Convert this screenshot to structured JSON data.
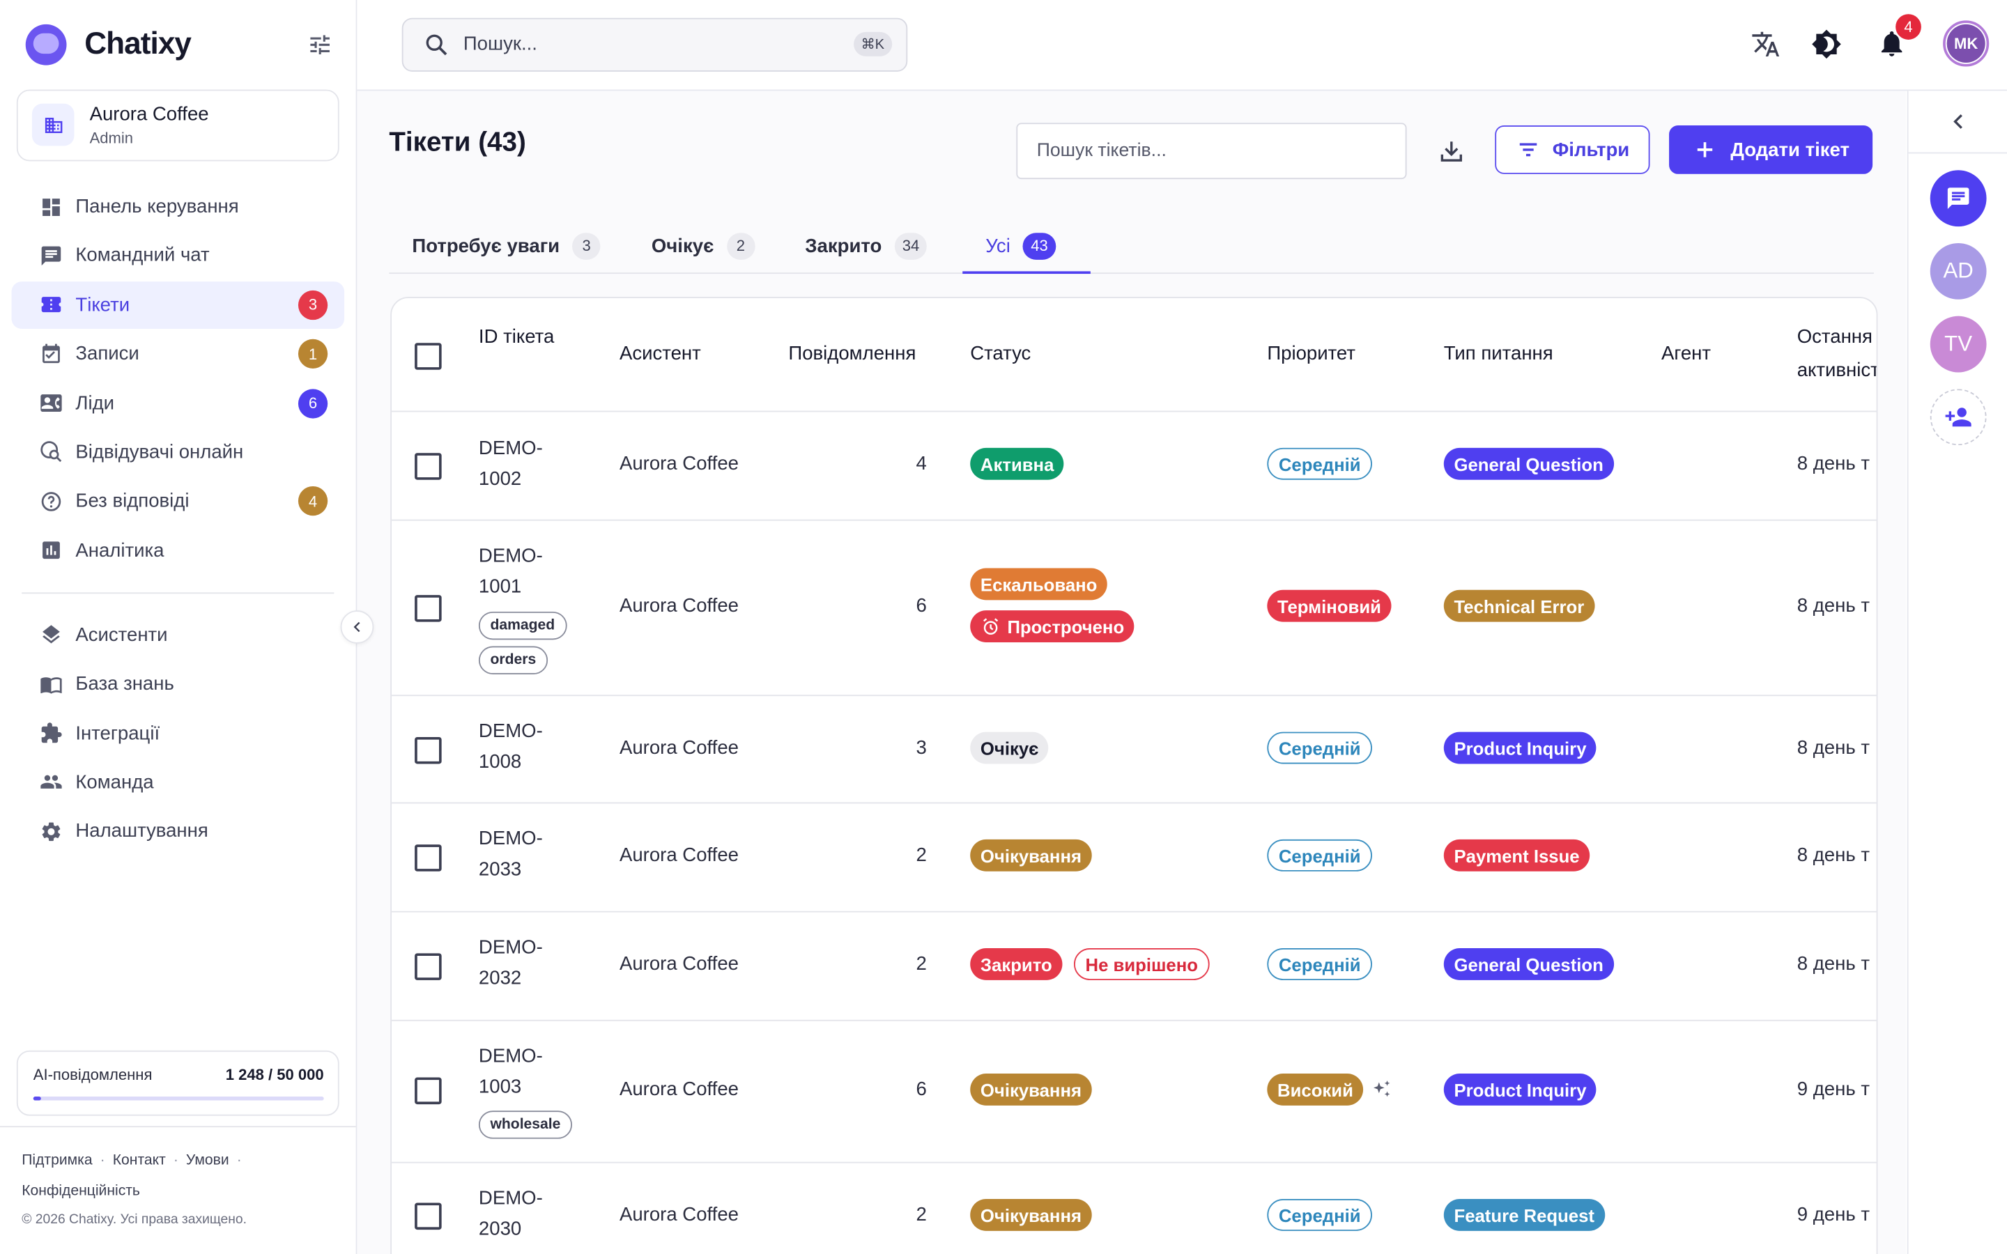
{
  "app": {
    "name": "Chatixy"
  },
  "org": {
    "name": "Aurora Coffee",
    "role": "Admin"
  },
  "nav": [
    {
      "label": "Панель керування",
      "icon": "dashboard-icon"
    },
    {
      "label": "Командний чат",
      "icon": "chat-icon"
    },
    {
      "label": "Тікети",
      "icon": "ticket-icon",
      "badge": "3",
      "active": true
    },
    {
      "label": "Записи",
      "icon": "calendar-icon",
      "badge": "1"
    },
    {
      "label": "Ліди",
      "icon": "contact-card-icon",
      "badge": "6"
    },
    {
      "label": "Відвідувачі онлайн",
      "icon": "visitors-icon"
    },
    {
      "label": "Без відповіді",
      "icon": "question-icon",
      "badge": "4"
    },
    {
      "label": "Аналітика",
      "icon": "analytics-icon"
    }
  ],
  "nav2": [
    {
      "label": "Асистенти",
      "icon": "layers-icon"
    },
    {
      "label": "База знань",
      "icon": "book-icon"
    },
    {
      "label": "Інтеграції",
      "icon": "puzzle-icon"
    },
    {
      "label": "Команда",
      "icon": "team-icon"
    },
    {
      "label": "Налаштування",
      "icon": "gear-icon"
    }
  ],
  "quota": {
    "label": "AI-повідомлення",
    "value": "1 248 / 50 000",
    "fraction": 0.025
  },
  "footer": {
    "links": [
      "Підтримка",
      "Контакт",
      "Умови",
      "Конфіденційність"
    ],
    "copyright": "© 2026 Chatixy. Усі права захищено."
  },
  "topbar": {
    "search_placeholder": "Пошук...",
    "shortcut": "⌘K",
    "notifications": "4",
    "user_initials": "MK"
  },
  "page": {
    "title": "Тікети (43)",
    "search_placeholder": "Пошук тікетів...",
    "filters_label": "Фільтри",
    "add_label": "Додати тікет"
  },
  "tabs": [
    {
      "label": "Потребує уваги",
      "count": "3"
    },
    {
      "label": "Очікує",
      "count": "2"
    },
    {
      "label": "Закрито",
      "count": "34"
    },
    {
      "label": "Усі",
      "count": "43",
      "active": true
    }
  ],
  "columns": {
    "id": "ID тікета",
    "assistant": "Асистент",
    "messages": "Повідомлення",
    "status": "Статус",
    "priority": "Пріоритет",
    "type": "Тип питання",
    "agent": "Агент",
    "last": "Остання активність"
  },
  "rows": [
    {
      "id1": "DEMO-",
      "id2": "1002",
      "assistant": "Aurora Coffee",
      "messages": "4",
      "status": "Активна",
      "priority": "Середній",
      "type": "General Question",
      "last": "8 день т"
    },
    {
      "id1": "DEMO-",
      "id2": "1001",
      "tags": [
        "damaged",
        "orders"
      ],
      "assistant": "Aurora Coffee",
      "messages": "6",
      "status": "Ескальовано",
      "status2": "Прострочено",
      "priority": "Терміновий",
      "type": "Technical Error",
      "last": "8 день т"
    },
    {
      "id1": "DEMO-",
      "id2": "1008",
      "assistant": "Aurora Coffee",
      "messages": "3",
      "status": "Очікує",
      "priority": "Середній",
      "type": "Product Inquiry",
      "last": "8 день т"
    },
    {
      "id1": "DEMO-",
      "id2": "2033",
      "assistant": "Aurora Coffee",
      "messages": "2",
      "status": "Очікування",
      "priority": "Середній",
      "type": "Payment Issue",
      "last": "8 день т"
    },
    {
      "id1": "DEMO-",
      "id2": "2032",
      "assistant": "Aurora Coffee",
      "messages": "2",
      "status": "Закрито",
      "status2": "Не вирішено",
      "priority": "Середній",
      "type": "General Question",
      "last": "8 день т"
    },
    {
      "id1": "DEMO-",
      "id2": "1003",
      "tags": [
        "wholesale"
      ],
      "assistant": "Aurora Coffee",
      "messages": "6",
      "status": "Очікування",
      "priority": "Високий",
      "type": "Product Inquiry",
      "last": "9 день т"
    },
    {
      "id1": "DEMO-",
      "id2": "2030",
      "assistant": "Aurora Coffee",
      "messages": "2",
      "status": "Очікування",
      "priority": "Середній",
      "type": "Feature Request",
      "last": "9 день т"
    }
  ],
  "right_rail": {
    "avatars": [
      "AD",
      "TV"
    ]
  },
  "colors": {
    "accent": "#4f3ff0",
    "red": "#e5394a",
    "amber": "#b88532",
    "green": "#0f9d6c",
    "orange": "#e07b34",
    "blue": "#3a8fc1"
  }
}
